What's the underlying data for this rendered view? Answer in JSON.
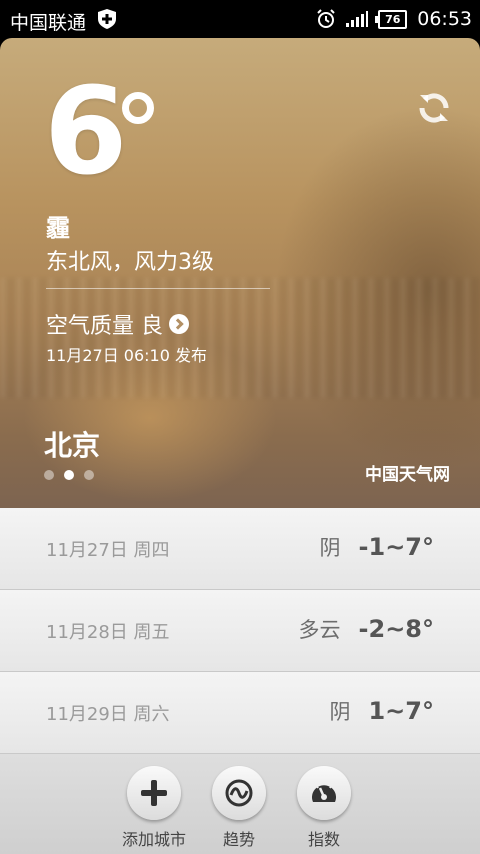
{
  "status_bar": {
    "carrier": "中国联通",
    "battery": "76",
    "time": "06:53"
  },
  "weather": {
    "temperature": "6",
    "condition": "霾",
    "wind": "东北风，风力3级",
    "air_quality": "空气质量 良",
    "publish_time": "11月27日 06:10 发布",
    "city": "北京",
    "source": "中国天气网",
    "pages": 3,
    "active_page": 2
  },
  "forecast": [
    {
      "date": "11月27日 周四",
      "condition": "阴",
      "range": "-1~7°"
    },
    {
      "date": "11月28日 周五",
      "condition": "多云",
      "range": "-2~8°"
    },
    {
      "date": "11月29日 周六",
      "condition": "阴",
      "range": "1~7°"
    }
  ],
  "toolbar": {
    "add_city": "添加城市",
    "trend": "趋势",
    "index": "指数"
  },
  "colors": {
    "hero_top": "#c6ab7b",
    "hero_bottom": "#7d6450",
    "list_bg": "#ededed"
  }
}
